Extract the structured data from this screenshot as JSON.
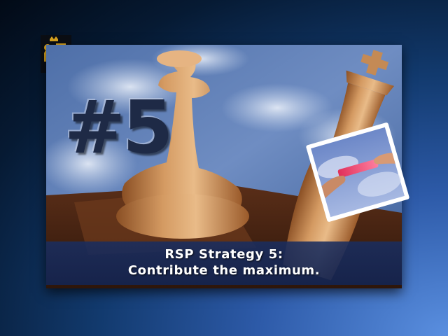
{
  "slide": {
    "number_label": "#5",
    "caption_line1": "RSP Strategy 5:",
    "caption_line2": "Contribute the maximum."
  },
  "logo": {
    "icon": "coat-of-arms-icon",
    "color": "#d9a420"
  },
  "colors": {
    "background_dark": "#020a16",
    "background_light": "#5a8fe0",
    "caption_band": "#1c2d5f",
    "caption_text": "#ffffff"
  }
}
